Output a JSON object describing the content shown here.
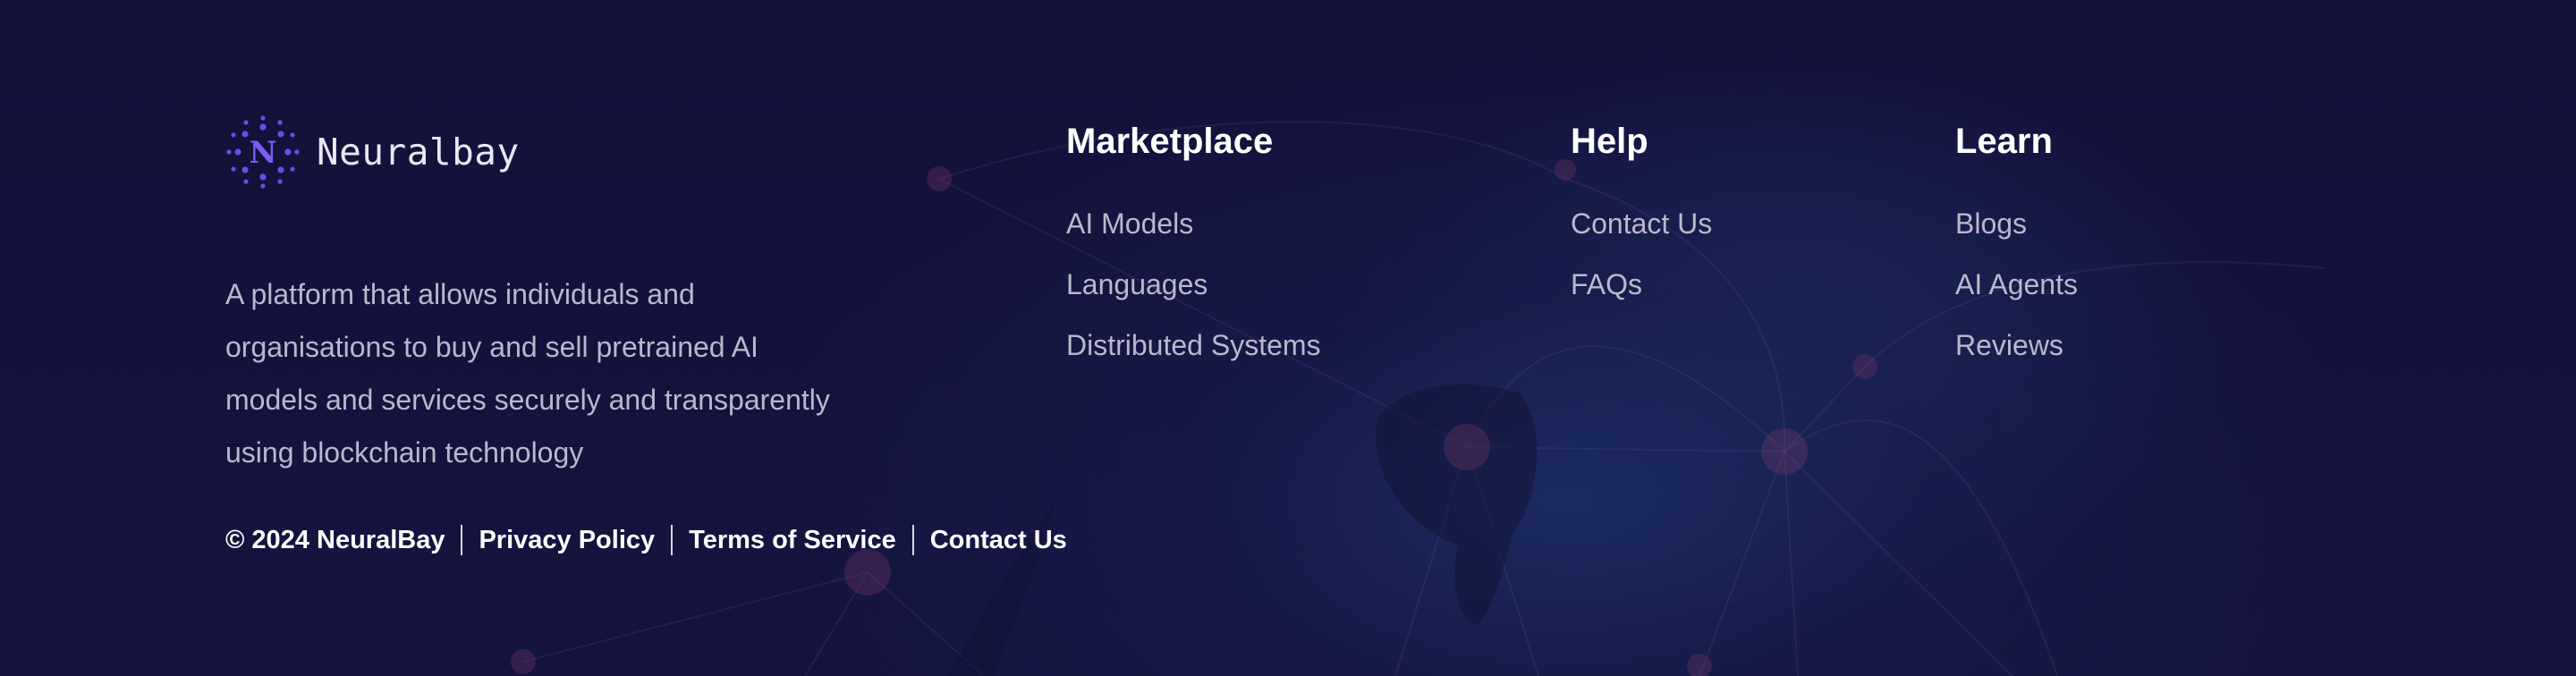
{
  "brand": {
    "logo_letter": "N",
    "name": "Neuralbay",
    "tagline": "A platform that allows individuals and organisations to buy and sell pretrained AI models and services securely and transparently using blockchain technology",
    "accent_color": "#6b4de6"
  },
  "columns": {
    "marketplace": {
      "title": "Marketplace",
      "links": [
        "AI Models",
        "Languages",
        "Distributed Systems"
      ]
    },
    "help": {
      "title": "Help",
      "links": [
        "Contact Us",
        "FAQs"
      ]
    },
    "learn": {
      "title": "Learn",
      "links": [
        "Blogs",
        "AI Agents",
        "Reviews"
      ]
    }
  },
  "bottom_bar": {
    "copyright": "© 2024 NeuralBay",
    "links": [
      "Privacy Policy",
      "Terms of Service",
      "Contact Us"
    ]
  },
  "colors": {
    "background": "#13113a",
    "text_muted": "#b9b8cc",
    "text_strong": "#ffffff"
  }
}
